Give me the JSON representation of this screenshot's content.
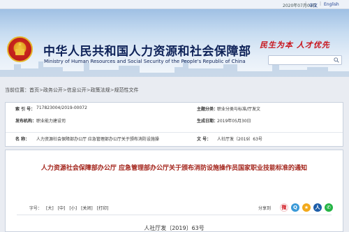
{
  "topbar": {
    "date": "2020年07月03日",
    "lang_cn": "中文",
    "lang_en": "English"
  },
  "header": {
    "title_cn": "中华人民共和国人力资源和社会保障部",
    "title_en": "Ministry of Human Resources and Social Security of the People's Republic of China",
    "slogan": "民生为本 人才优先",
    "search_placeholder": "",
    "emblem_icon": "national-emblem",
    "search_icon": "magnifier"
  },
  "breadcrumb": {
    "prefix": "当前位置：",
    "items": [
      "首页",
      "政务公开",
      "信息公开",
      "政策法规",
      "规范性文件"
    ],
    "separator": ">"
  },
  "info": {
    "index_label": "索  引  号：",
    "index_value": "717823004/2019-00072",
    "category_label": "主题分类：",
    "category_value": "职业分类与标准/厅发文",
    "publisher_label": "发布机构：",
    "publisher_value": "职业能力建设司",
    "date_label": "生成日期：",
    "date_value": "2019年05月30日",
    "name_label": "名      称：",
    "name_value": "人力资源社会保障部办公厅 应急管理部办公厅关于颁布消防设施操",
    "docno_label": "文      号：",
    "docno_value": "人社厅发〔2019〕63号"
  },
  "article": {
    "headline": "人力资源社会保障部办公厅 应急管理部办公厅关于颁布消防设施操作员国家职业技能标准的通知",
    "font_label": "字号：",
    "font_options": [
      "[大]",
      "[中]",
      "[小]",
      "[关闭]",
      "[打印]"
    ],
    "share_label": "分享到",
    "share_icons": [
      "weibo-icon",
      "qq-icon",
      "qzone-icon",
      "renren-icon",
      "wechat-icon"
    ],
    "doc_number": "人社厅发〔2019〕63号"
  },
  "colors": {
    "title_navy": "#0e2258",
    "slogan_red": "#c8141c",
    "headline_red": "#a3241b",
    "page_bg": "#e9ecf2"
  }
}
